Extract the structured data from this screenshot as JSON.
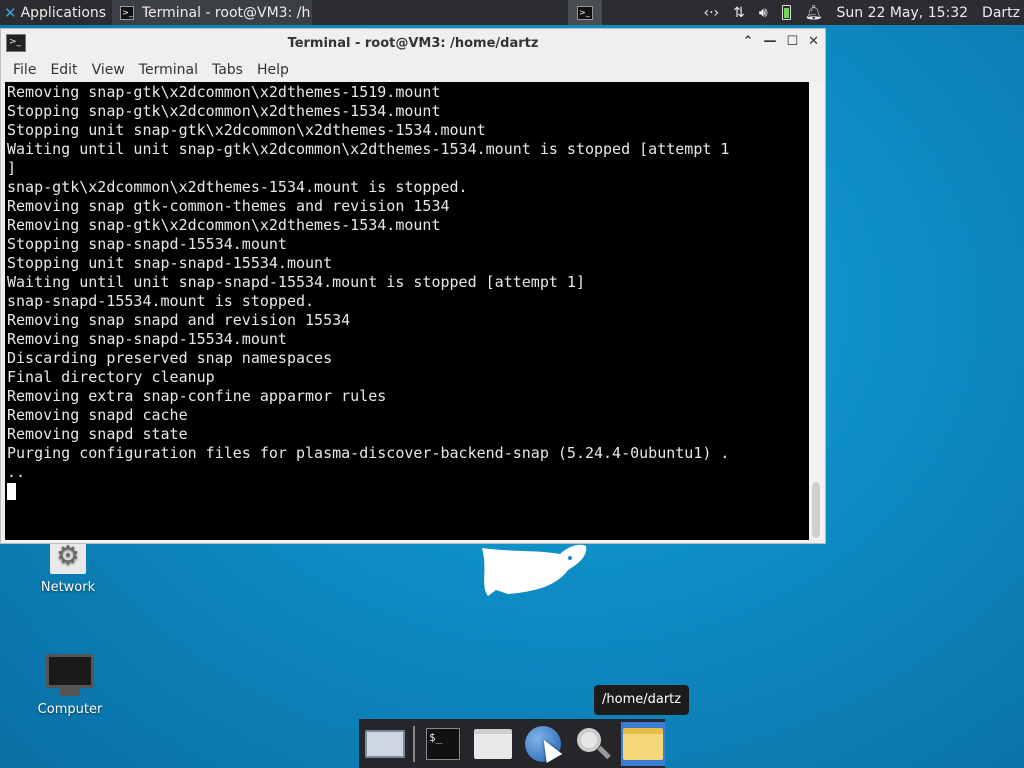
{
  "panel": {
    "applications_label": "Applications",
    "task_title": "Terminal - root@VM3: /h...",
    "datetime": "Sun 22 May, 15:32",
    "user": "Dartz"
  },
  "window": {
    "title": "Terminal - root@VM3: /home/dartz",
    "menu": [
      "File",
      "Edit",
      "View",
      "Terminal",
      "Tabs",
      "Help"
    ]
  },
  "terminal": {
    "lines": [
      "Removing snap-gtk\\x2dcommon\\x2dthemes-1519.mount",
      "Stopping snap-gtk\\x2dcommon\\x2dthemes-1534.mount",
      "Stopping unit snap-gtk\\x2dcommon\\x2dthemes-1534.mount",
      "Waiting until unit snap-gtk\\x2dcommon\\x2dthemes-1534.mount is stopped [attempt 1",
      "]",
      "snap-gtk\\x2dcommon\\x2dthemes-1534.mount is stopped.",
      "Removing snap gtk-common-themes and revision 1534",
      "Removing snap-gtk\\x2dcommon\\x2dthemes-1534.mount",
      "Stopping snap-snapd-15534.mount",
      "Stopping unit snap-snapd-15534.mount",
      "Waiting until unit snap-snapd-15534.mount is stopped [attempt 1]",
      "snap-snapd-15534.mount is stopped.",
      "Removing snap snapd and revision 15534",
      "Removing snap-snapd-15534.mount",
      "Discarding preserved snap namespaces",
      "Final directory cleanup",
      "Removing extra snap-confine apparmor rules",
      "Removing snapd cache",
      "Removing snapd state",
      "Purging configuration files for plasma-discover-backend-snap (5.24.4-0ubuntu1) .",
      ".."
    ]
  },
  "desktop": {
    "network_label": "Network",
    "computer_label": "Computer"
  },
  "dock": {
    "tooltip": "/home/dartz",
    "terminal_glyph": "$_"
  }
}
